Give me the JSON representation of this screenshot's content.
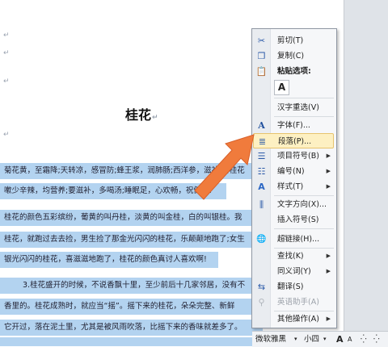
{
  "document": {
    "paragraph_mark": "↵",
    "title": "桂花",
    "paragraph_lines": [
      "菊花黄，至霜降;天转凉，感冒防;蜂王浆，润肺肠;西洋参，滋补强;桂花",
      "嗽少辛辣，均营养;要滋补，多喝汤;睡眠足，心欢畅，祝健康!",
      "桂花的颜色五彩缤纷，葡黄的叫丹桂，淡黄的叫金桂，白的叫银桂。我",
      "桂花，就跑过去去捡，男生捡了那金光闪闪的桂花，乐颠颠地跑了;女生",
      "银光闪闪的桂花，喜滋滋地跑了，桂花的颜色真讨人喜欢啊!",
      "3.桂花盛开的时候，不说香飘十里，至少前后十几家邻居，没有不",
      "香里的。桂花成熟时，就应当“摇”。摇下来的桂花，朵朵完整、新鲜",
      "它开过，落在泥土里，尤其是被风雨吹落，比摇下来的香味就差多了。"
    ]
  },
  "context_menu": {
    "items": [
      {
        "label": "剪切(T)",
        "icon": "scissors-icon",
        "glyph": "✂"
      },
      {
        "label": "复制(C)",
        "icon": "copy-icon",
        "glyph": "❐"
      },
      {
        "label": "粘贴选项:",
        "icon": "paste-icon",
        "glyph": "📋",
        "bold": true
      },
      {
        "label": "汉字重选(V)",
        "icon": "",
        "glyph": ""
      },
      {
        "label": "字体(F)...",
        "icon": "font-icon",
        "glyph": "A"
      },
      {
        "label": "段落(P)...",
        "icon": "paragraph-icon",
        "glyph": "≣"
      },
      {
        "label": "项目符号(B)",
        "icon": "bullets-icon",
        "glyph": "☰",
        "submenu": true
      },
      {
        "label": "编号(N)",
        "icon": "numbering-icon",
        "glyph": "☷",
        "submenu": true
      },
      {
        "label": "样式(T)",
        "icon": "styles-icon",
        "glyph": "A",
        "submenu": true
      },
      {
        "label": "文字方向(X)...",
        "icon": "text-direction-icon",
        "glyph": "⫼"
      },
      {
        "label": "插入符号(S)",
        "icon": "",
        "glyph": ""
      },
      {
        "label": "超链接(H)...",
        "icon": "hyperlink-icon",
        "glyph": "🌐"
      },
      {
        "label": "查找(K)",
        "icon": "",
        "glyph": "",
        "submenu": true
      },
      {
        "label": "同义词(Y)",
        "icon": "",
        "glyph": "",
        "submenu": true
      },
      {
        "label": "翻译(S)",
        "icon": "translate-icon",
        "glyph": "⇆"
      },
      {
        "label": "英语助手(A)",
        "icon": "english-assistant-icon",
        "glyph": "⚲",
        "disabled": true
      },
      {
        "label": "其他操作(A)",
        "icon": "",
        "glyph": "",
        "submenu": true
      }
    ],
    "paste_option": "A",
    "submenu_arrow": "▶"
  },
  "mini_toolbar": {
    "font": "微软雅黑",
    "size": "小四",
    "grow": "A",
    "shrink": "A",
    "more": "⁛"
  },
  "colors": {
    "selection": "#b3d3f0",
    "highlight": "#fdf0c2",
    "arrow": "#f07b3c"
  }
}
